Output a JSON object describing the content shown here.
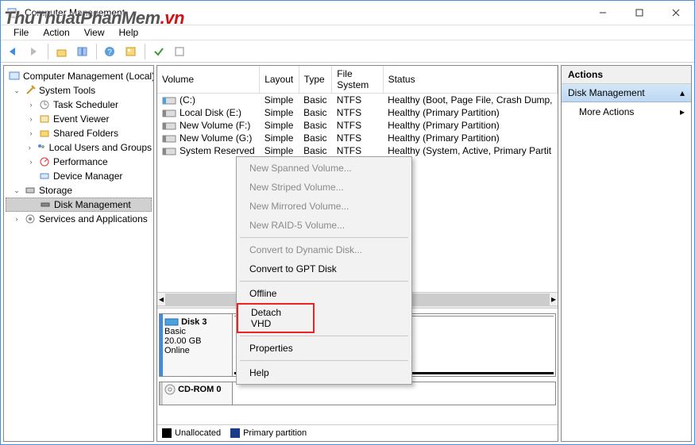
{
  "watermark_pre": "ThuThuatPhanMem",
  "watermark_suf": ".vn",
  "title": "Computer Management",
  "menu": {
    "file": "File",
    "action": "Action",
    "view": "View",
    "help": "Help"
  },
  "tree": {
    "root": "Computer Management (Local)",
    "sys_tools": "System Tools",
    "task_sched": "Task Scheduler",
    "event_viewer": "Event Viewer",
    "shared_folders": "Shared Folders",
    "local_users": "Local Users and Groups",
    "performance": "Performance",
    "device_manager": "Device Manager",
    "storage": "Storage",
    "disk_management": "Disk Management",
    "services_apps": "Services and Applications"
  },
  "columns": {
    "volume": "Volume",
    "layout": "Layout",
    "type": "Type",
    "fs": "File System",
    "status": "Status"
  },
  "volumes": [
    {
      "name": "(C:)",
      "layout": "Simple",
      "type": "Basic",
      "fs": "NTFS",
      "status": "Healthy (Boot, Page File, Crash Dump,",
      "color": "#4aa3df"
    },
    {
      "name": "Local Disk (E:)",
      "layout": "Simple",
      "type": "Basic",
      "fs": "NTFS",
      "status": "Healthy (Primary Partition)",
      "color": "#888"
    },
    {
      "name": "New Volume (F:)",
      "layout": "Simple",
      "type": "Basic",
      "fs": "NTFS",
      "status": "Healthy (Primary Partition)",
      "color": "#888"
    },
    {
      "name": "New Volume (G:)",
      "layout": "Simple",
      "type": "Basic",
      "fs": "NTFS",
      "status": "Healthy (Primary Partition)",
      "color": "#888"
    },
    {
      "name": "System Reserved",
      "layout": "Simple",
      "type": "Basic",
      "fs": "NTFS",
      "status": "Healthy (System, Active, Primary Partit",
      "color": "#888"
    }
  ],
  "ctx_menu": {
    "spanned": "New Spanned Volume...",
    "striped": "New Striped Volume...",
    "mirrored": "New Mirrored Volume...",
    "raid5": "New RAID-5 Volume...",
    "convert_dyn": "Convert to Dynamic Disk...",
    "convert_gpt": "Convert to GPT Disk",
    "offline": "Offline",
    "detach": "Detach VHD",
    "properties": "Properties",
    "help": "Help"
  },
  "disk3": {
    "title": "Disk 3",
    "type": "Basic",
    "size": "20.00 GB",
    "status": "Online",
    "part_status": "Unallocated"
  },
  "cdrom": {
    "title": "CD-ROM 0"
  },
  "legend": {
    "unalloc": "Unallocated",
    "primary": "Primary partition"
  },
  "actions": {
    "header": "Actions",
    "disk_mgmt": "Disk Management",
    "more": "More Actions"
  }
}
